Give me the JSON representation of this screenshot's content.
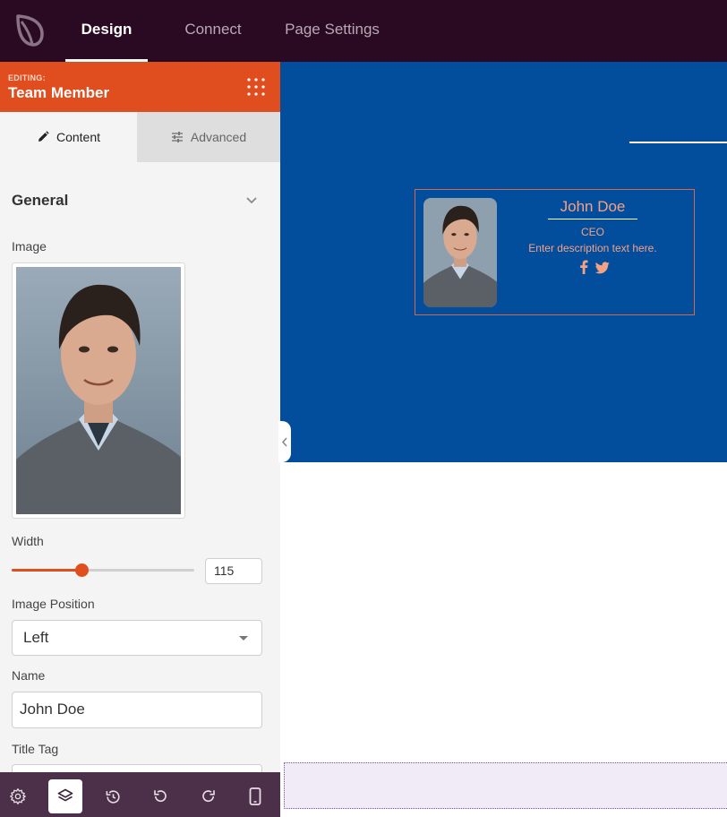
{
  "topbar": {
    "tabs": [
      {
        "label": "Design",
        "active": true
      },
      {
        "label": "Connect",
        "active": false
      },
      {
        "label": "Page Settings",
        "active": false
      }
    ],
    "bg_color": "#2a0a22"
  },
  "sidebar": {
    "editing_small": "EDITING:",
    "editing_title": "Team Member",
    "header_color": "#e04d1f",
    "tabs": [
      {
        "label": "Content",
        "icon": "pencil-icon",
        "active": true
      },
      {
        "label": "Advanced",
        "icon": "sliders-icon",
        "active": false
      }
    ],
    "section": {
      "title": "General",
      "expanded": true
    },
    "fields": {
      "image_label": "Image",
      "width_label": "Width",
      "width_value": "115",
      "width_slider_fraction": 0.38,
      "image_position_label": "Image Position",
      "image_position_value": "Left",
      "name_label": "Name",
      "name_value": "John Doe",
      "title_tag_label": "Title Tag"
    }
  },
  "toolbar": {
    "tools": [
      {
        "icon": "gear-icon"
      },
      {
        "icon": "layers-icon",
        "active": true
      },
      {
        "icon": "history-icon"
      },
      {
        "icon": "undo-icon"
      },
      {
        "icon": "redo-icon"
      },
      {
        "icon": "mobile-preview-icon"
      }
    ]
  },
  "canvas": {
    "bg_color": "#034d9d",
    "card": {
      "name": "John Doe",
      "role": "CEO",
      "description": "Enter description text here.",
      "text_color": "#f5a183",
      "social_icons": [
        "facebook-icon",
        "twitter-icon"
      ]
    }
  }
}
